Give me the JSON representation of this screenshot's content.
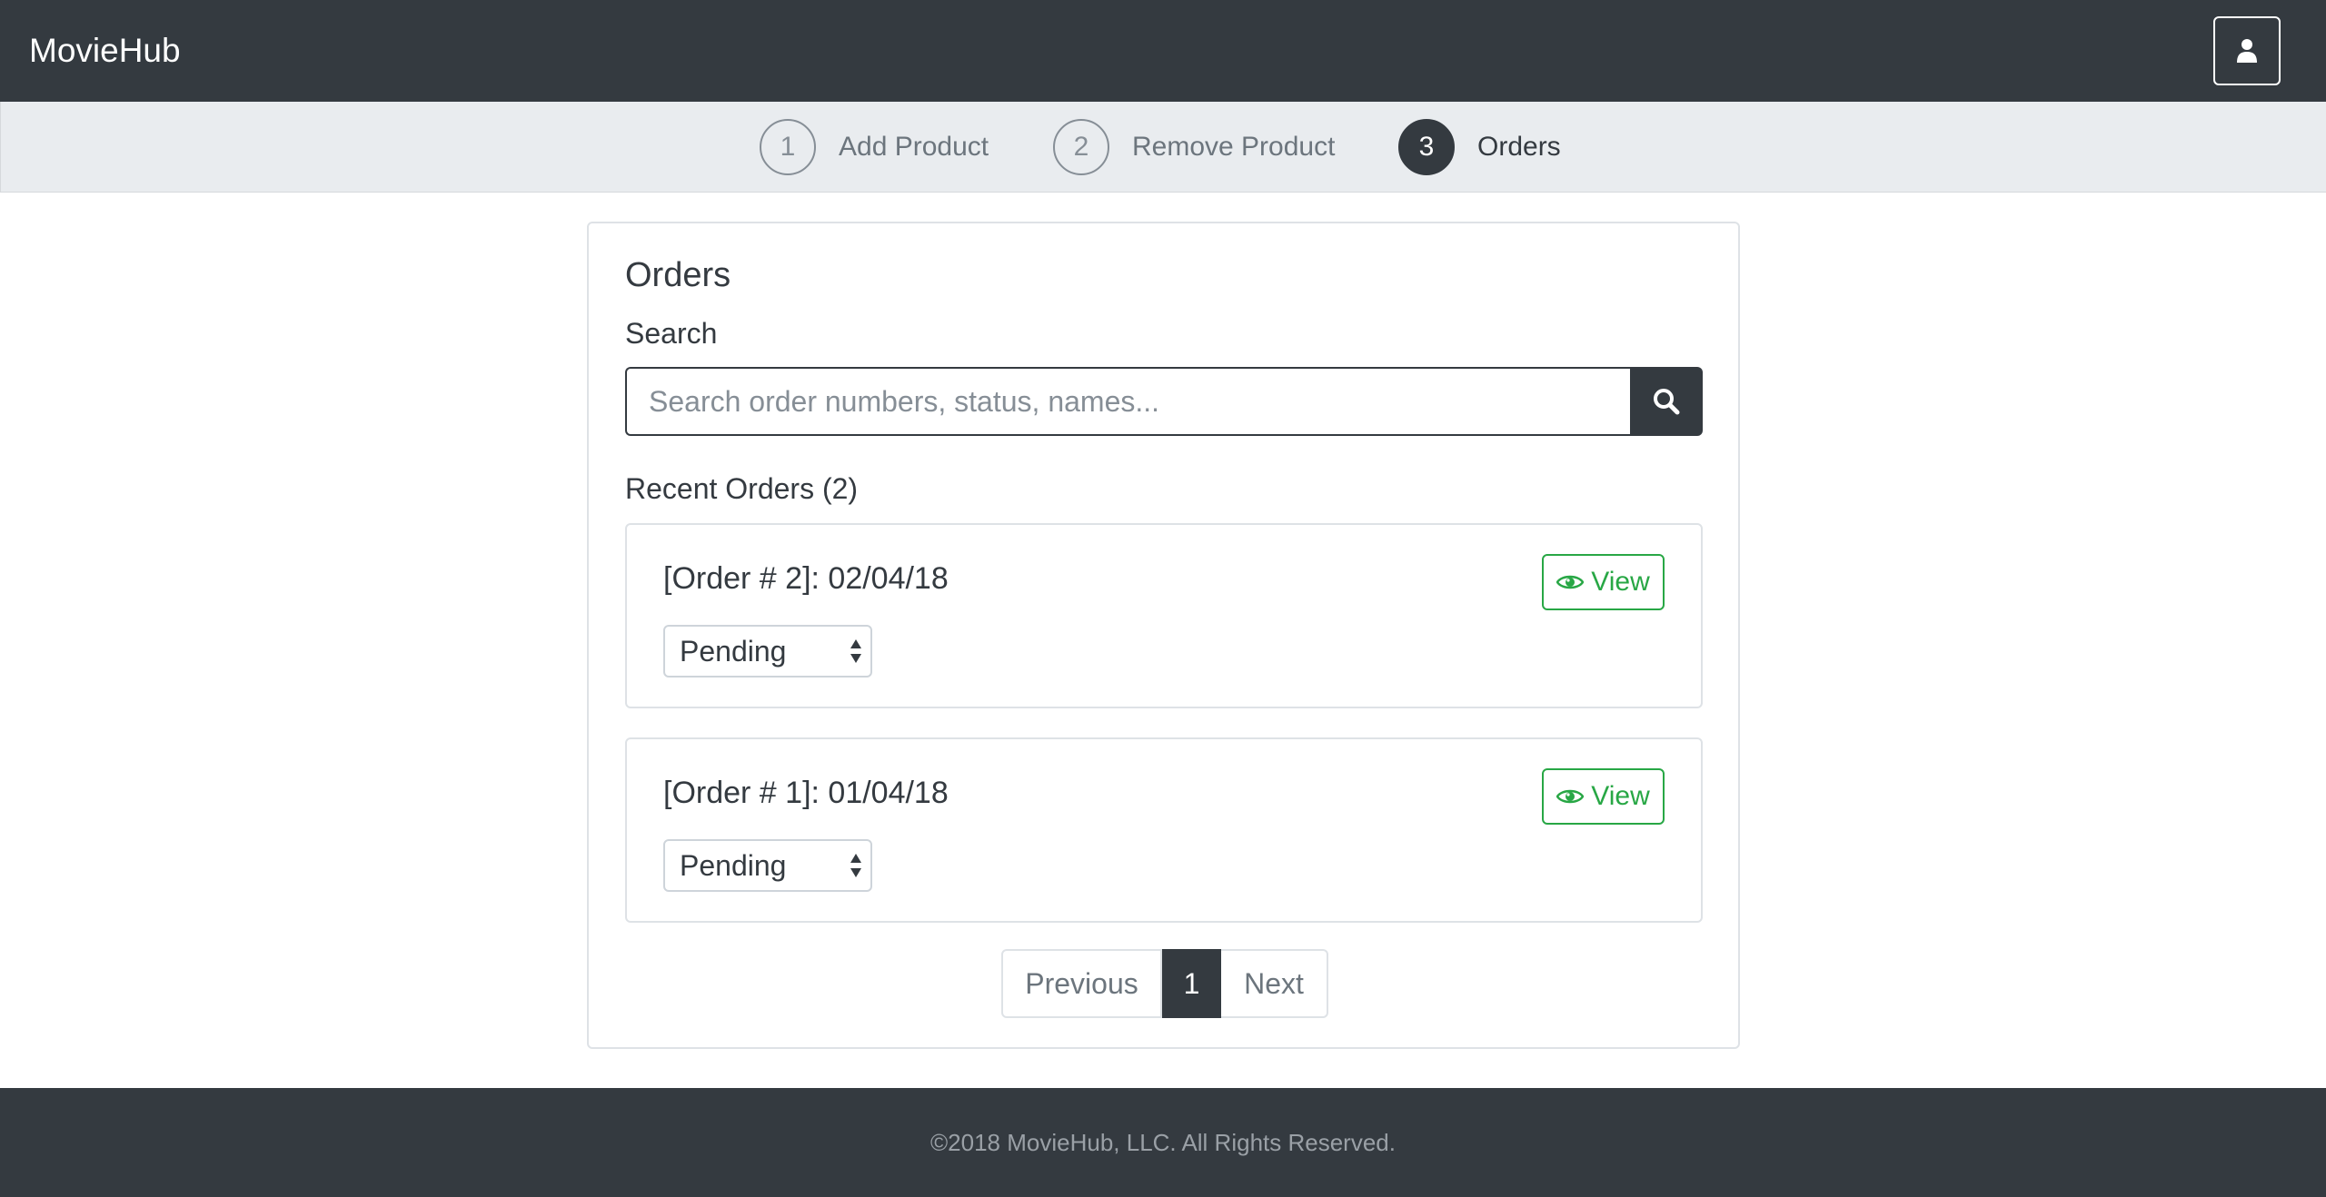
{
  "navbar": {
    "brand": "MovieHub",
    "user_icon": "user-icon"
  },
  "steps": [
    {
      "number": "1",
      "label": "Add Product",
      "active": false
    },
    {
      "number": "2",
      "label": "Remove Product",
      "active": false
    },
    {
      "number": "3",
      "label": "Orders",
      "active": true
    }
  ],
  "main": {
    "title": "Orders",
    "search": {
      "label": "Search",
      "placeholder": "Search order numbers, status, names...",
      "value": "",
      "icon": "search-icon"
    },
    "recent_title": "Recent Orders (2)",
    "orders": [
      {
        "title": "[Order # 2]: 02/04/18",
        "status": "Pending",
        "view_label": "View"
      },
      {
        "title": "[Order # 1]: 01/04/18",
        "status": "Pending",
        "view_label": "View"
      }
    ],
    "pagination": {
      "previous": "Previous",
      "current": "1",
      "next": "Next"
    }
  },
  "footer": {
    "text": "©2018 MovieHub, LLC. All Rights Reserved."
  },
  "colors": {
    "dark": "#343a40",
    "light_bar": "#e9ecef",
    "success": "#28a745",
    "muted": "#6c757d"
  }
}
